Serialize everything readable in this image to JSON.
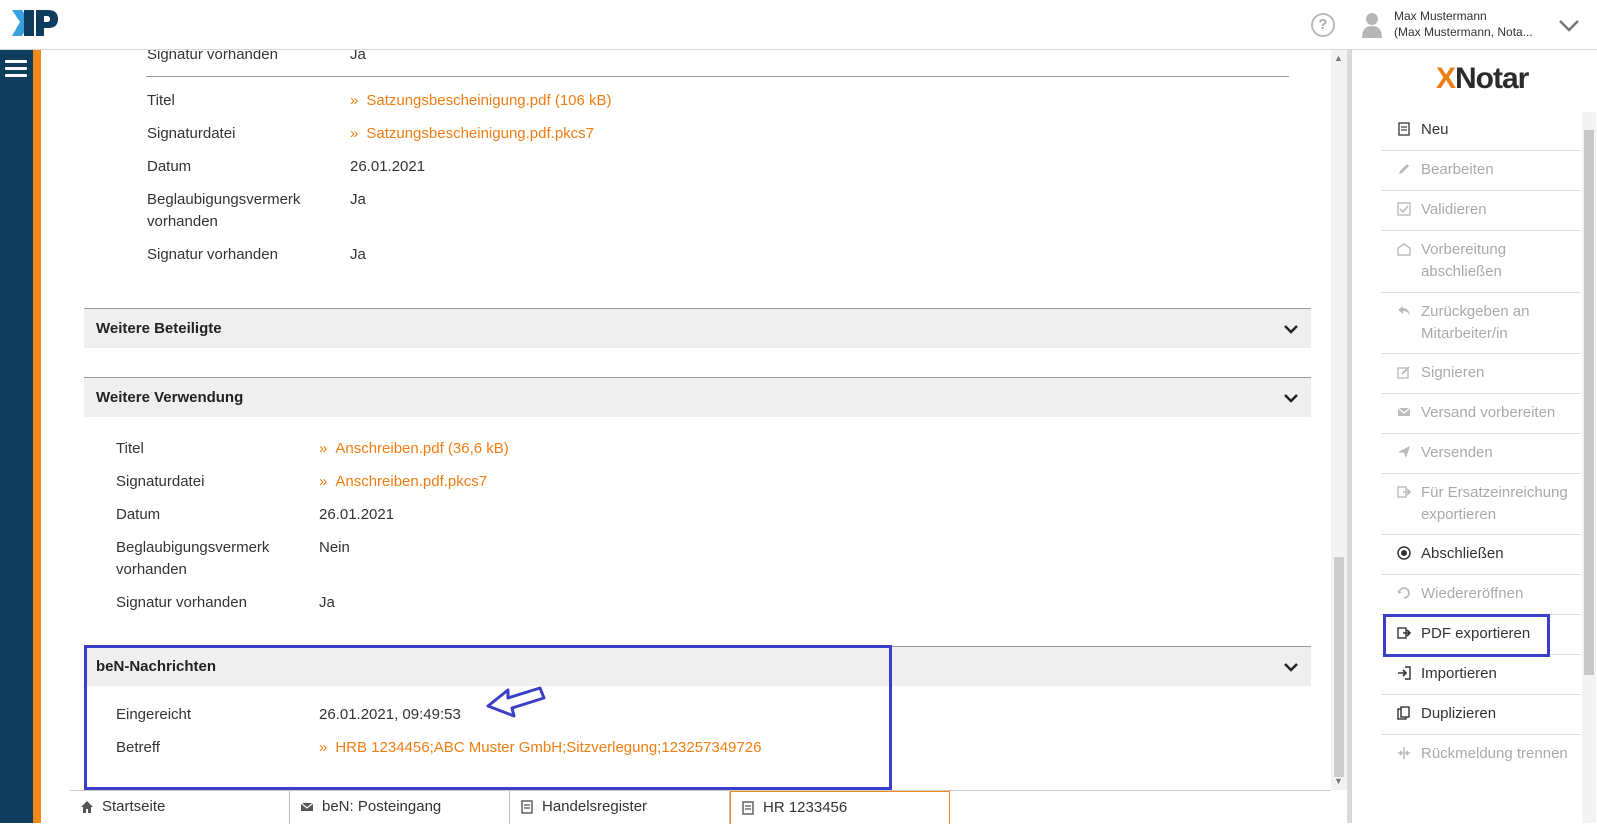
{
  "header": {
    "logo_text": "XNP",
    "user_line1": "Max Mustermann",
    "user_line2": "(Max Mustermann, Nota...",
    "help_glyph": "?"
  },
  "top_section": {
    "sig_label": "Signatur vorhanden",
    "sig_value": "Ja",
    "titel_label": "Titel",
    "titel_value": "Satzungsbescheinigung.pdf (106 kB)",
    "sigfile_label": "Signaturdatei",
    "sigfile_value": "Satzungsbescheinigung.pdf.pkcs7",
    "datum_label": "Datum",
    "datum_value": "26.01.2021",
    "beglaub_label_1": "Beglaubigungsvermerk",
    "beglaub_label_2": "vorhanden",
    "beglaub_value": "Ja",
    "sig2_label": "Signatur vorhanden",
    "sig2_value": "Ja"
  },
  "sections": {
    "weitere_beteiligte": "Weitere Beteiligte",
    "weitere_verwendung": "Weitere Verwendung",
    "ben_nachrichten": "beN-Nachrichten"
  },
  "verwendung": {
    "titel_label": "Titel",
    "titel_value": "Anschreiben.pdf (36,6 kB)",
    "sigfile_label": "Signaturdatei",
    "sigfile_value": "Anschreiben.pdf.pkcs7",
    "datum_label": "Datum",
    "datum_value": "26.01.2021",
    "beglaub_label_1": "Beglaubigungsvermerk",
    "beglaub_label_2": "vorhanden",
    "beglaub_value": "Nein",
    "sig_label": "Signatur vorhanden",
    "sig_value": "Ja"
  },
  "ben": {
    "eingereicht_label": "Eingereicht",
    "eingereicht_value": "26.01.2021, 09:49:53",
    "betreff_label": "Betreff",
    "betreff_value": "HRB 1234456;ABC Muster GmbH;Sitzverlegung;123257349726"
  },
  "tabs": [
    {
      "label": "Startseite",
      "icon": "home-icon"
    },
    {
      "label": "beN: Posteingang",
      "icon": "envelope-icon"
    },
    {
      "label": "Handelsregister",
      "icon": "document-icon"
    },
    {
      "label": "HR 1233456",
      "icon": "document-icon"
    }
  ],
  "right_panel": {
    "logo_x": "X",
    "logo_rest": "Notar",
    "menu": [
      {
        "label": "Neu",
        "icon": "new-document-icon",
        "disabled": false
      },
      {
        "label": "Bearbeiten",
        "icon": "pencil-icon",
        "disabled": true
      },
      {
        "label": "Validieren",
        "icon": "checkbox-icon",
        "disabled": true
      },
      {
        "label": "Vorbereitung abschließen",
        "icon": "envelope-open-icon",
        "disabled": true
      },
      {
        "label": "Zurückgeben an Mitarbeiter/in",
        "icon": "reply-icon",
        "disabled": true
      },
      {
        "label": "Signieren",
        "icon": "sign-icon",
        "disabled": true
      },
      {
        "label": "Versand vorbereiten",
        "icon": "envelope-icon",
        "disabled": true
      },
      {
        "label": "Versenden",
        "icon": "send-icon",
        "disabled": true
      },
      {
        "label": "Für Ersatzeinreichung exportieren",
        "icon": "export-icon",
        "disabled": true
      },
      {
        "label": "Abschließen",
        "icon": "target-icon",
        "disabled": false
      },
      {
        "label": "Wiedereröffnen",
        "icon": "reopen-icon",
        "disabled": true
      },
      {
        "label": "PDF exportieren",
        "icon": "export-icon",
        "disabled": false
      },
      {
        "label": "Importieren",
        "icon": "import-icon",
        "disabled": false
      },
      {
        "label": "Duplizieren",
        "icon": "duplicate-icon",
        "disabled": false
      },
      {
        "label": "Rückmeldung trennen",
        "icon": "split-icon",
        "disabled": true
      }
    ]
  },
  "colors": {
    "accent_orange": "#ef7d12",
    "nav_blue": "#0e3d5e",
    "highlight_box": "#3a3ec8"
  }
}
